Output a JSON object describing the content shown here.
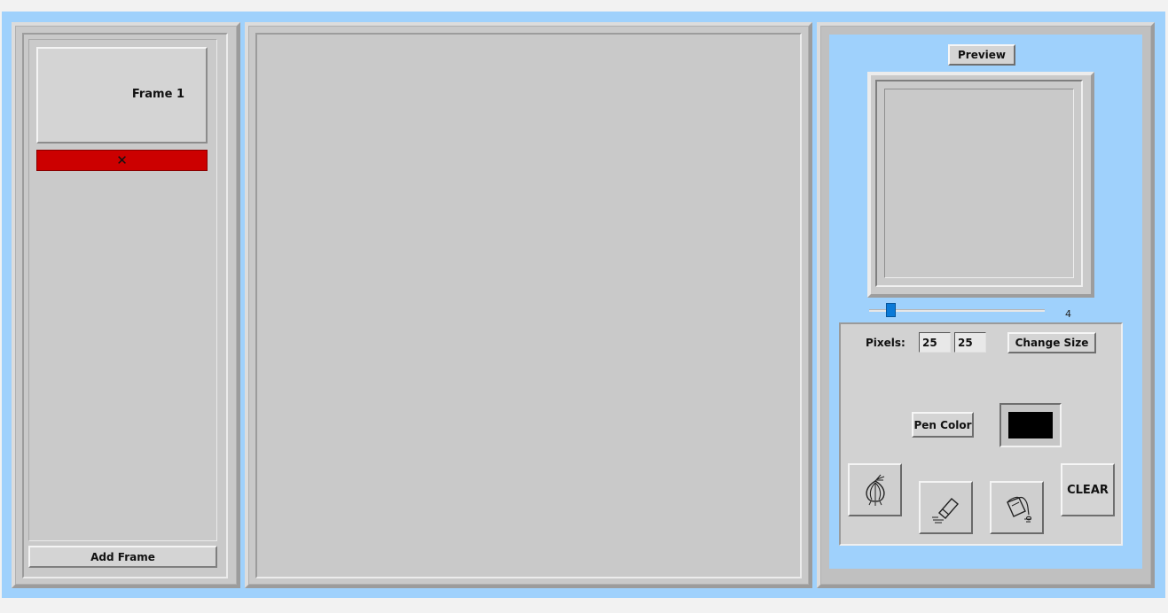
{
  "frames": {
    "items": [
      {
        "label": "Frame 1",
        "delete_glyph": "✕"
      }
    ],
    "add_label": "Add Frame"
  },
  "preview": {
    "button_label": "Preview",
    "speed_value": "4",
    "speed_level": 4,
    "speed_min": 1,
    "speed_max": 30
  },
  "settings": {
    "pixels_label": "Pixels:",
    "width": "25",
    "height": "25",
    "change_size_label": "Change Size",
    "pen_color_label": "Pen Color",
    "pen_color": "#000000"
  },
  "tools": {
    "onion_icon": "onion-icon",
    "eraser_icon": "eraser-icon",
    "fill_icon": "paint-bucket-icon",
    "clear_label": "CLEAR"
  },
  "colors": {
    "background_blue": "#9fd1fc",
    "panel_gray": "#c9c9c9",
    "delete_red": "#cc0000",
    "slider_thumb": "#0a7ad8"
  }
}
